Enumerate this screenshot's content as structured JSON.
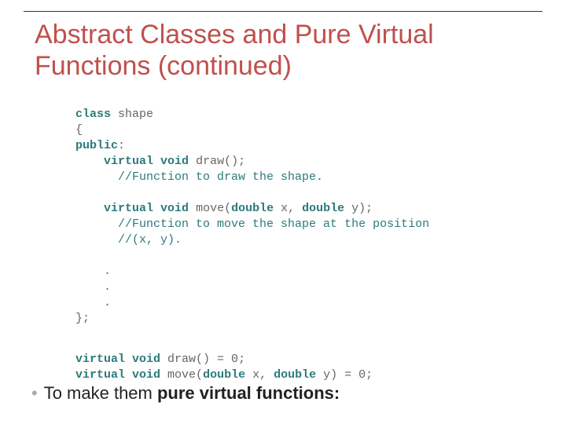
{
  "title": "Abstract Classes and Pure Virtual Functions (continued)",
  "code1": {
    "l1_kw": "class",
    "l1_name": " shape",
    "l2": "{",
    "l3_kw": "public",
    "l3_colon": ":",
    "l4_kw1": "virtual",
    "l4_kw2": "void",
    "l4_rest": " draw();",
    "l5_cm": "//Function to draw the shape.",
    "l6_kw1": "virtual",
    "l6_kw2": "void",
    "l6_rest": " move(",
    "l6_kw3": "double",
    "l6_x": " x, ",
    "l6_kw4": "double",
    "l6_y": " y);",
    "l7_cm": "//Function to move the shape at the position",
    "l8_cm": "//(x, y).",
    "d1": ".",
    "d2": ".",
    "d3": ".",
    "l9": "};"
  },
  "code2": {
    "l1_kw1": "virtual",
    "l1_kw2": "void",
    "l1_rest": " draw() = 0;",
    "l2_kw1": "virtual",
    "l2_kw2": "void",
    "l2_rest": " move(",
    "l2_kw3": "double",
    "l2_x": " x, ",
    "l2_kw4": "double",
    "l2_y": " y) = 0;"
  },
  "bullet": {
    "pre": "To make them ",
    "bold": "pure virtual functions:"
  }
}
